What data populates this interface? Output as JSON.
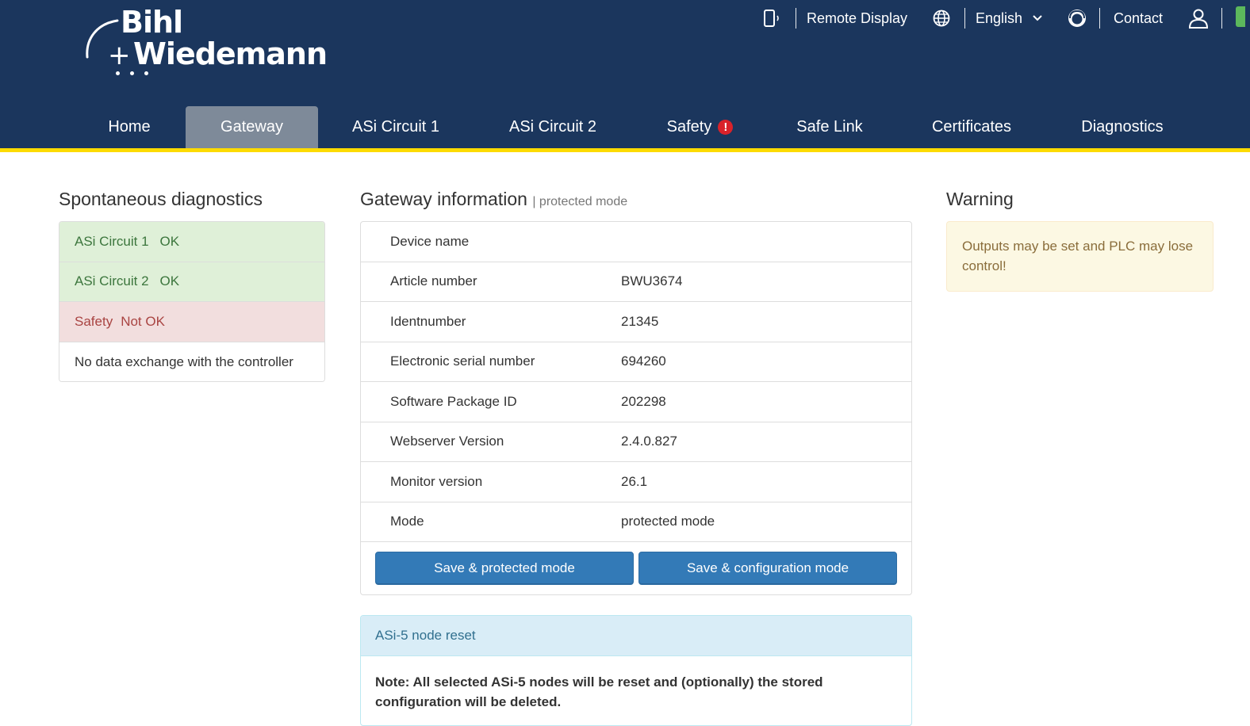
{
  "brand": {
    "line1": "Bihl",
    "line2": "Wiedemann",
    "plus": "+"
  },
  "topbar": {
    "remote_display": "Remote Display",
    "language": "English",
    "contact": "Contact"
  },
  "nav": {
    "items": [
      {
        "label": "Home"
      },
      {
        "label": "Gateway"
      },
      {
        "label": "ASi Circuit 1"
      },
      {
        "label": "ASi Circuit 2"
      },
      {
        "label": "Safety"
      },
      {
        "label": "Safe Link"
      },
      {
        "label": "Certificates"
      },
      {
        "label": "Diagnostics"
      }
    ],
    "active": "Gateway"
  },
  "diagnostics": {
    "title": "Spontaneous diagnostics",
    "rows": [
      {
        "name": "ASi Circuit 1",
        "status": "OK"
      },
      {
        "name": "ASi Circuit 2",
        "status": "OK"
      },
      {
        "name": "Safety",
        "status": "Not OK"
      },
      {
        "name": "No data exchange with the controller",
        "status": ""
      }
    ]
  },
  "gateway": {
    "title": "Gateway information",
    "subtitle": "| protected mode",
    "rows": [
      {
        "label": "Device name",
        "value": ""
      },
      {
        "label": "Article number",
        "value": "BWU3674"
      },
      {
        "label": "Identnumber",
        "value": "21345"
      },
      {
        "label": "Electronic serial number",
        "value": "694260"
      },
      {
        "label": "Software Package ID",
        "value": "202298"
      },
      {
        "label": "Webserver Version",
        "value": "2.4.0.827"
      },
      {
        "label": "Monitor version",
        "value": "26.1"
      },
      {
        "label": "Mode",
        "value": "protected mode"
      }
    ],
    "buttons": {
      "save_protected": "Save & protected mode",
      "save_config": "Save & configuration mode"
    }
  },
  "node_reset": {
    "title": "ASi-5 node reset",
    "note": "Note: All selected ASi-5 nodes will be reset and (optionally) the stored configuration will be deleted."
  },
  "warning": {
    "title": "Warning",
    "text": "Outputs may be set and PLC may lose control!"
  },
  "colors": {
    "header_bg": "#1b365d",
    "accent_yellow": "#fddb00",
    "active_tab": "#7e8a99",
    "button_primary": "#337ab7",
    "alert_red": "#d9222a"
  }
}
